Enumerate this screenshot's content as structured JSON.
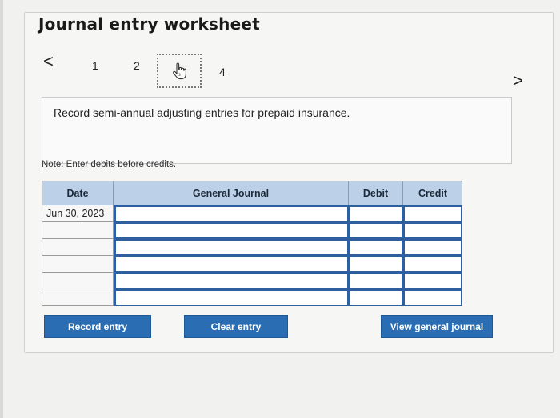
{
  "title": "Journal entry worksheet",
  "nav": {
    "prev": "<",
    "next": ">",
    "steps": [
      "1",
      "2",
      "3",
      "4"
    ],
    "current_step": "3"
  },
  "instruction": "Record semi-annual adjusting entries for prepaid insurance.",
  "note": "Note: Enter debits before credits.",
  "table": {
    "headers": {
      "date": "Date",
      "general_journal": "General Journal",
      "debit": "Debit",
      "credit": "Credit"
    },
    "rows": [
      {
        "date": "Jun 30, 2023",
        "account": "",
        "debit": "",
        "credit": ""
      },
      {
        "date": "",
        "account": "",
        "debit": "",
        "credit": ""
      },
      {
        "date": "",
        "account": "",
        "debit": "",
        "credit": ""
      },
      {
        "date": "",
        "account": "",
        "debit": "",
        "credit": ""
      },
      {
        "date": "",
        "account": "",
        "debit": "",
        "credit": ""
      },
      {
        "date": "",
        "account": "",
        "debit": "",
        "credit": ""
      }
    ]
  },
  "buttons": {
    "record": "Record entry",
    "clear": "Clear entry",
    "view": "View general journal"
  },
  "colors": {
    "accent": "#2b6db3",
    "header": "#bcd1e8",
    "cell_border": "#2f5f9e"
  }
}
